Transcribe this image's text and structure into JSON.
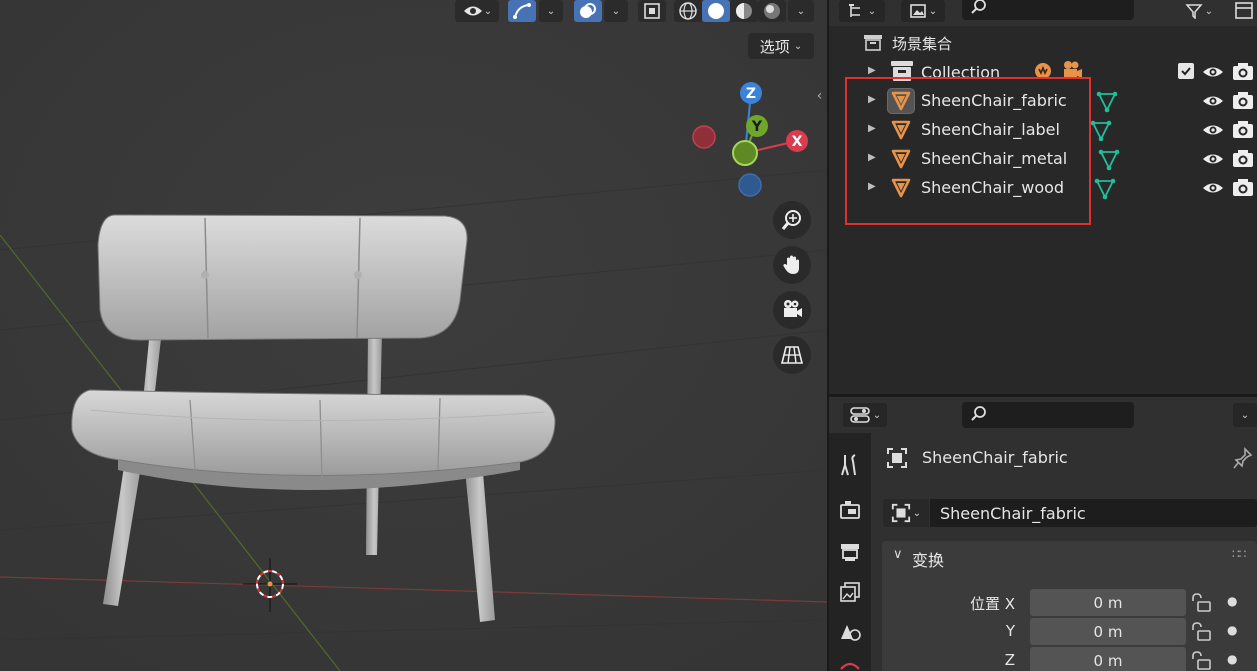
{
  "viewport": {
    "options_label": "选项",
    "gizmo": {
      "z": "Z",
      "y": "Y",
      "x": "X"
    }
  },
  "outliner": {
    "scene_collection_label": "场景集合",
    "collection_label": "Collection",
    "objects": [
      {
        "name": "SheenChair_fabric",
        "active": true
      },
      {
        "name": "SheenChair_label",
        "active": false
      },
      {
        "name": "SheenChair_metal",
        "active": false
      },
      {
        "name": "SheenChair_wood",
        "active": false
      }
    ]
  },
  "properties": {
    "object_title": "SheenChair_fabric",
    "object_name_field": "SheenChair_fabric",
    "transform_panel_label": "变换",
    "location": [
      {
        "label": "位置 X",
        "value": "0 m"
      },
      {
        "label": "Y",
        "value": "0 m"
      },
      {
        "label": "Z",
        "value": "0 m"
      }
    ]
  },
  "colors": {
    "object_orange": "#e8934a",
    "mesh_teal": "#1fbf9a",
    "highlight_red": "#e03131",
    "gizmo_x": "#d93b4f",
    "gizmo_y": "#6fa62b",
    "gizmo_z": "#3b82d9"
  }
}
